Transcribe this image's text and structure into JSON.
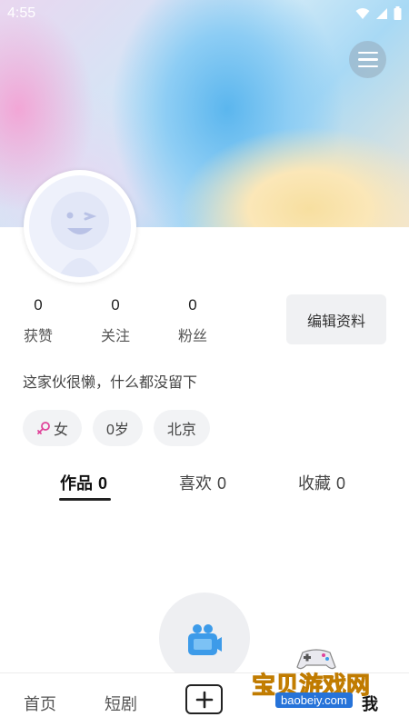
{
  "status_bar": {
    "time": "4:55"
  },
  "profile": {
    "stats": [
      {
        "value": "0",
        "label": "获赞"
      },
      {
        "value": "0",
        "label": "关注"
      },
      {
        "value": "0",
        "label": "粉丝"
      }
    ],
    "edit_label": "编辑资料",
    "bio": "这家伙很懒，什么都没留下",
    "tags": {
      "gender": "女",
      "age": "0岁",
      "city": "北京"
    }
  },
  "tabs": [
    {
      "label": "作品",
      "count": "0",
      "active": true
    },
    {
      "label": "喜欢",
      "count": "0",
      "active": false
    },
    {
      "label": "收藏",
      "count": "0",
      "active": false
    }
  ],
  "bottom_nav": {
    "home": "首页",
    "drama": "短剧",
    "me": "我"
  },
  "watermark": {
    "line1": "宝贝游戏网",
    "line2": "baobeiy.com"
  },
  "icons": {
    "menu": "hamburger-icon",
    "gender": "female-icon",
    "record": "video-camera-icon",
    "add": "plus-icon"
  },
  "colors": {
    "gender_icon": "#e0439a",
    "record_icon": "#3d9be9"
  }
}
